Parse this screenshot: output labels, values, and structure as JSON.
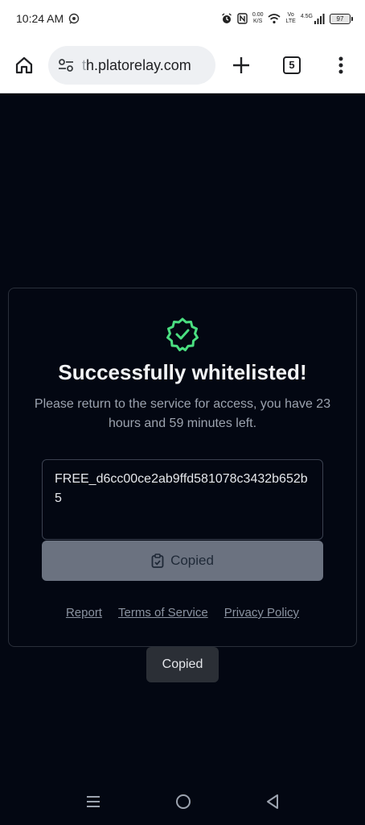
{
  "status_bar": {
    "time": "10:24 AM",
    "net_speed_value": "0.00",
    "net_speed_unit": "K/S",
    "volte_top": "Vo",
    "volte_bottom": "LTE",
    "network": "4.5G",
    "battery": "97"
  },
  "browser": {
    "url_prefix": "t",
    "url_main": "h.platorelay.com",
    "tab_count": "5"
  },
  "card": {
    "title": "Successfully whitelisted!",
    "subtitle": "Please return to the service for access, you have 23 hours and 59 minutes left.",
    "key": "FREE_d6cc00ce2ab9ffd581078c3432b652b5",
    "copy_button_label": "Copied",
    "links": [
      "Report",
      "Terms of Service",
      "Privacy Policy"
    ]
  },
  "toast": "Copied",
  "colors": {
    "background": "#030712",
    "success_green": "#4ade80",
    "button_gray": "#6b7280"
  }
}
